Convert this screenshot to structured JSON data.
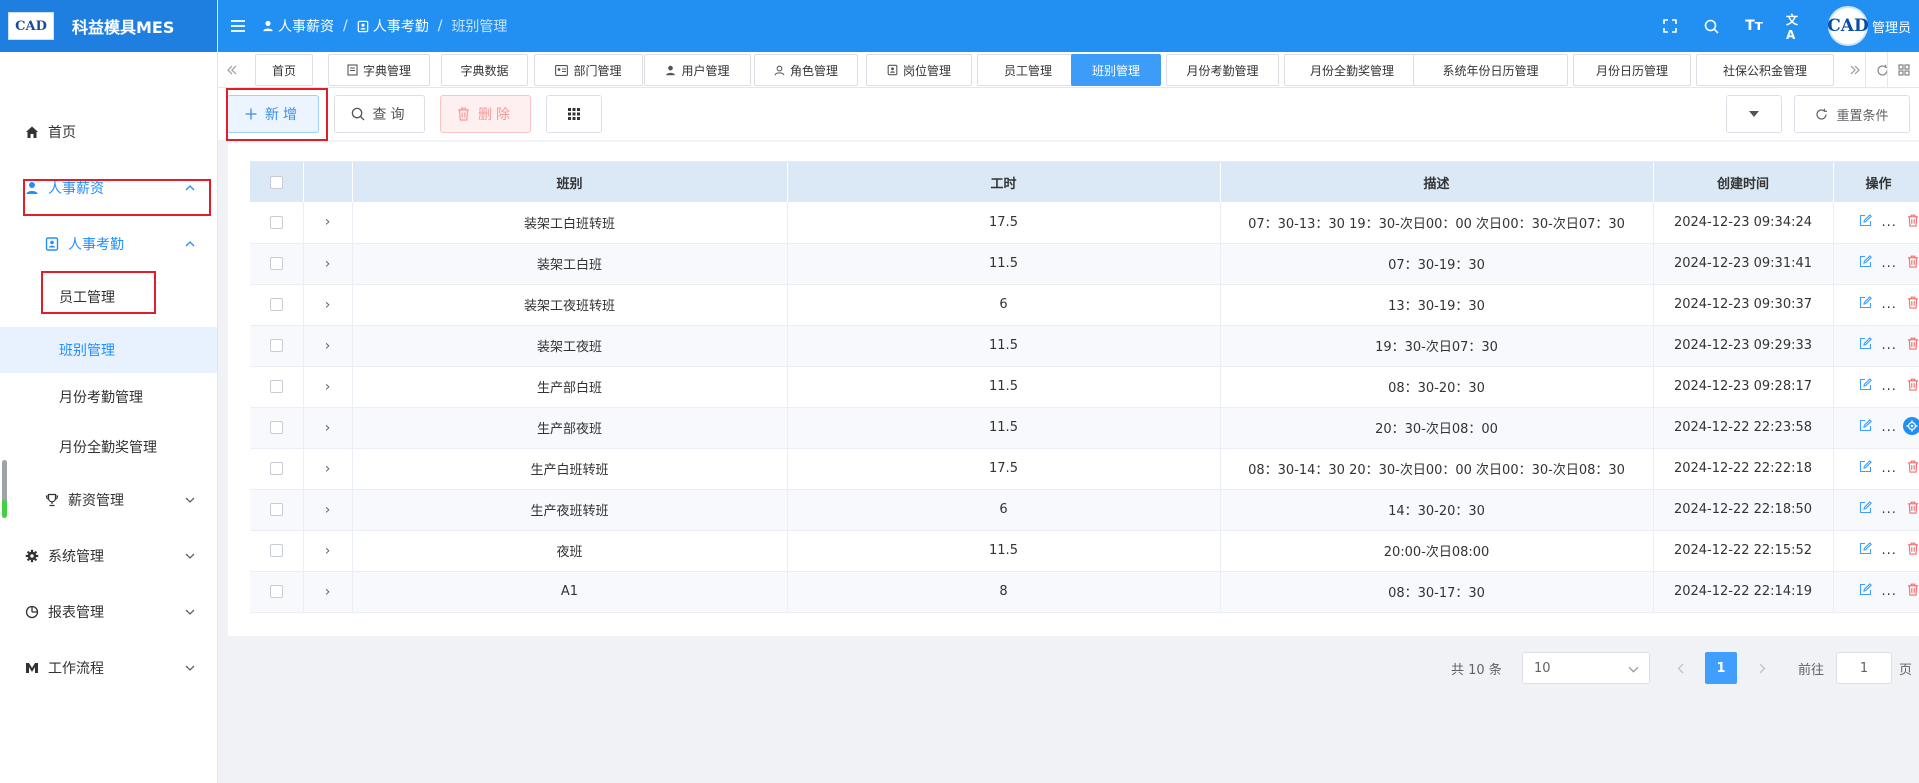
{
  "app": {
    "logo_text": "CAD",
    "title": "科益模具MES"
  },
  "breadcrumb": {
    "level1": "人事薪资",
    "level2": "人事考勤",
    "current": "班别管理"
  },
  "user": {
    "avatar_text": "CAD",
    "name": "管理员"
  },
  "header_icons": {
    "fullscreen": "fullscreen-icon",
    "search": "search-icon",
    "font_size_label": "Tт",
    "translate_label": "文A"
  },
  "sidebar": {
    "home": "首页",
    "hr": "人事薪资",
    "attendance": "人事考勤",
    "employee": "员工管理",
    "shift": "班别管理",
    "monthly_attendance": "月份考勤管理",
    "monthly_bonus": "月份全勤奖管理",
    "salary": "薪资管理",
    "system": "系统管理",
    "report": "报表管理",
    "workflow": "工作流程"
  },
  "tabs": [
    {
      "label": "首页"
    },
    {
      "label": "字典管理"
    },
    {
      "label": "字典数据"
    },
    {
      "label": "部门管理"
    },
    {
      "label": "用户管理"
    },
    {
      "label": "角色管理"
    },
    {
      "label": "岗位管理"
    },
    {
      "label": "员工管理"
    },
    {
      "label": "班别管理"
    },
    {
      "label": "月份考勤管理"
    },
    {
      "label": "月份全勤奖管理"
    },
    {
      "label": "系统年份日历管理"
    },
    {
      "label": "月份日历管理"
    },
    {
      "label": "社保公积金管理"
    }
  ],
  "toolbar": {
    "add": "新增",
    "query": "查询",
    "delete": "删除",
    "reset": "重置条件"
  },
  "table": {
    "columns": {
      "shift": "班别",
      "hours": "工时",
      "desc": "描述",
      "created": "创建时间",
      "ops": "操作"
    },
    "more_label": "...",
    "rows": [
      {
        "shift": "装架工白班转班",
        "hours": "17.5",
        "desc": "07：30-13：30 19：30-次日00：00 次日00：30-次日07：30",
        "created": "2024-12-23 09:34:24"
      },
      {
        "shift": "装架工白班",
        "hours": "11.5",
        "desc": "07：30-19：30",
        "created": "2024-12-23 09:31:41"
      },
      {
        "shift": "装架工夜班转班",
        "hours": "6",
        "desc": "13：30-19：30",
        "created": "2024-12-23 09:30:37"
      },
      {
        "shift": "装架工夜班",
        "hours": "11.5",
        "desc": "19：30-次日07：30",
        "created": "2024-12-23 09:29:33"
      },
      {
        "shift": "生产部白班",
        "hours": "11.5",
        "desc": "08：30-20：30",
        "created": "2024-12-23 09:28:17"
      },
      {
        "shift": "生产部夜班",
        "hours": "11.5",
        "desc": "20：30-次日08：00",
        "created": "2024-12-22 22:23:58"
      },
      {
        "shift": "生产白班转班",
        "hours": "17.5",
        "desc": "08：30-14：30 20：30-次日00：00 次日00：30-次日08：30",
        "created": "2024-12-22 22:22:18"
      },
      {
        "shift": "生产夜班转班",
        "hours": "6",
        "desc": "14：30-20：30",
        "created": "2024-12-22 22:18:50"
      },
      {
        "shift": "夜班",
        "hours": "11.5",
        "desc": "20:00-次日08:00",
        "created": "2024-12-22 22:15:52"
      },
      {
        "shift": "A1",
        "hours": "8",
        "desc": "08：30-17：30",
        "created": "2024-12-22 22:14:19"
      }
    ]
  },
  "pagination": {
    "total_text": "共 10 条",
    "page_size": "10",
    "current_page": "1",
    "goto_label": "前往",
    "goto_value": "1",
    "page_unit": "页"
  },
  "colors": {
    "primary": "#2290f3",
    "active_tab": "#3d9cf8",
    "danger": "#f56c6c",
    "highlight_box": "#e11d2a"
  }
}
